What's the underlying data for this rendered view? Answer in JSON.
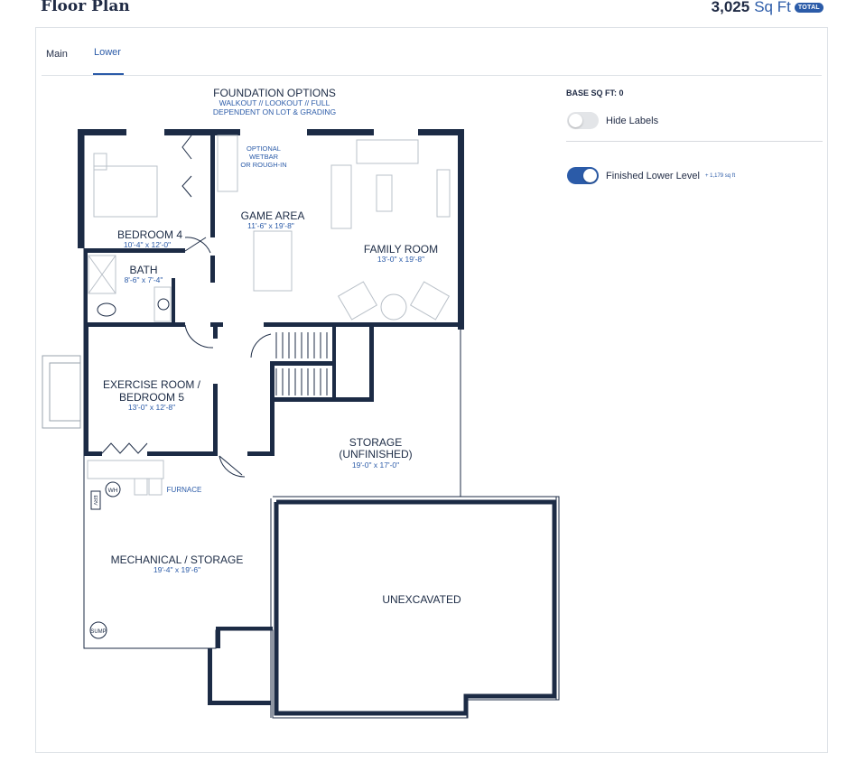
{
  "header": {
    "title": "Floor Plan",
    "total_sqft": "3,025",
    "sqft_unit": "Sq Ft",
    "total_badge": "TOTAL"
  },
  "tabs": [
    {
      "label": "Main",
      "active": false
    },
    {
      "label": "Lower",
      "active": true
    }
  ],
  "controls": {
    "base_sqft_label": "BASE SQ FT: 0",
    "hide_labels": {
      "label": "Hide Labels",
      "on": false
    },
    "finished_lower": {
      "label": "Finished Lower Level",
      "sub": "+ 1,179 sq ft",
      "on": true
    }
  },
  "plan": {
    "foundation": {
      "title": "FOUNDATION OPTIONS",
      "line1": "WALKOUT // LOOKOUT // FULL",
      "line2": "DEPENDENT ON LOT & GRADING"
    },
    "wetbar": {
      "line1": "OPTIONAL",
      "line2": "WETBAR",
      "line3": "OR ROUGH-IN"
    },
    "rooms": {
      "bedroom4": {
        "name": "BEDROOM 4",
        "dims": "10'-4\" x 12'-0\""
      },
      "bath": {
        "name": "BATH",
        "dims": "8'-6\" x 7'-4\""
      },
      "game": {
        "name": "GAME AREA",
        "dims": "11'-6\" x 19'-8\""
      },
      "family": {
        "name": "FAMILY ROOM",
        "dims": "13'-0\" x 19'-8\""
      },
      "exercise": {
        "name1": "EXERCISE ROOM /",
        "name2": "BEDROOM 5",
        "dims": "13'-0\" x 12'-8\""
      },
      "storage": {
        "name1": "STORAGE",
        "name2": "(UNFINISHED)",
        "dims": "19'-0\" x 17'-0\""
      },
      "mechanical": {
        "name": "MECHANICAL / STORAGE",
        "dims": "19'-4\" x 19'-6\""
      },
      "unexcavated": {
        "name": "UNEXCAVATED"
      }
    },
    "fixtures": {
      "furnace": "FURNACE",
      "wh": "WH",
      "erv": "ERV",
      "sump": "SUMP"
    }
  },
  "colors": {
    "wall": "#1c2b45",
    "accent": "#2b5ba8",
    "border": "#dde1e6"
  }
}
